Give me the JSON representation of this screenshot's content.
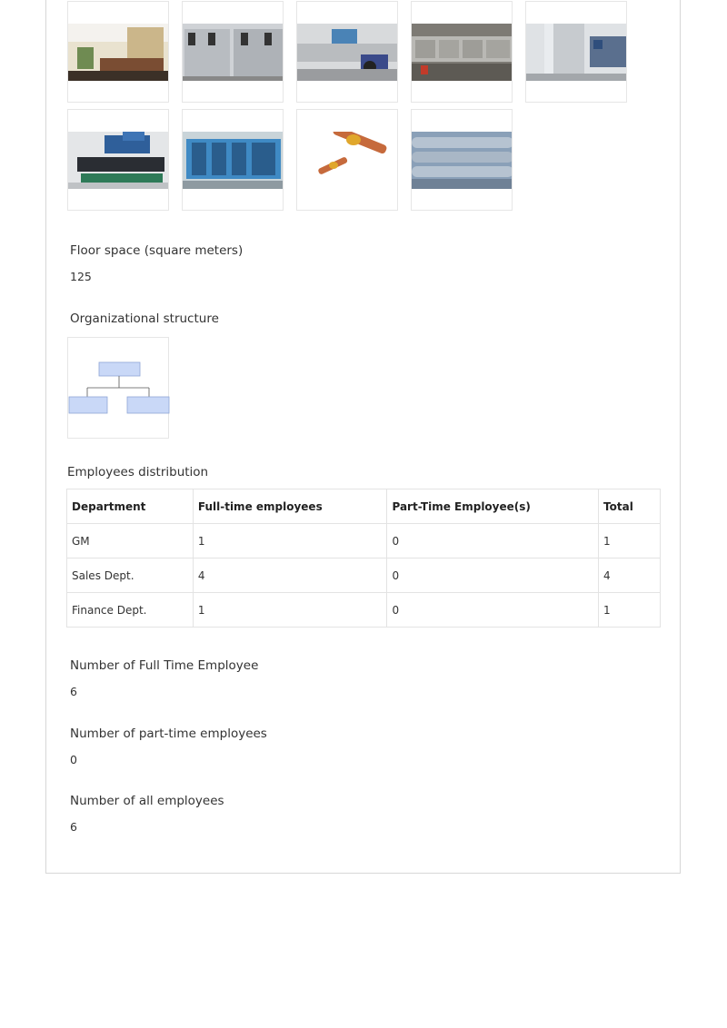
{
  "gallery": [
    {
      "icon": "office-room-photo"
    },
    {
      "icon": "ice-machine-units-photo"
    },
    {
      "icon": "ice-plant-photo"
    },
    {
      "icon": "ice-machine-row-photo"
    },
    {
      "icon": "flake-ice-tank-photo"
    },
    {
      "icon": "compressor-unit-photo"
    },
    {
      "icon": "refrigeration-rack-photo"
    },
    {
      "icon": "brass-valve-photo"
    },
    {
      "icon": "condenser-tubes-photo"
    }
  ],
  "floor_space": {
    "label": "Floor space (square meters)",
    "value": "125"
  },
  "org_structure": {
    "label": "Organizational structure"
  },
  "employees_distribution": {
    "label": "Employees distribution",
    "columns": [
      "Department",
      "Full-time employees",
      "Part-Time Employee(s)",
      "Total"
    ],
    "rows": [
      [
        "GM",
        "1",
        "0",
        "1"
      ],
      [
        "Sales Dept.",
        "4",
        "0",
        "4"
      ],
      [
        "Finance Dept.",
        "1",
        "0",
        "1"
      ]
    ]
  },
  "full_time": {
    "label": "Number of Full Time Employee",
    "value": "6"
  },
  "part_time": {
    "label": "Number of part-time employees",
    "value": "0"
  },
  "all_employees": {
    "label": "Number of all employees",
    "value": "6"
  },
  "colors": {
    "border": "#d7d7d7",
    "org_box": "#c9d8f7",
    "org_box_border": "#8fa6d6"
  }
}
